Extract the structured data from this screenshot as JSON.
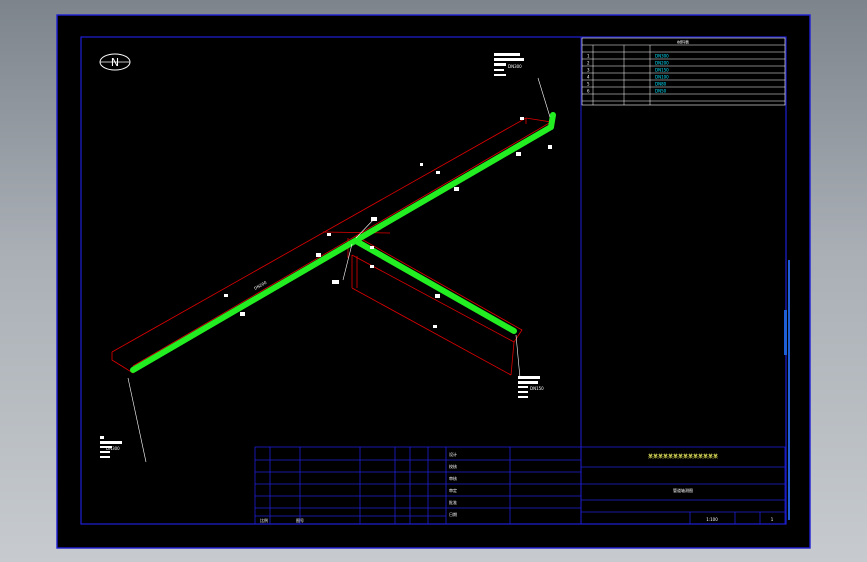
{
  "colors": {
    "background": "#000000",
    "frame": "#1f1fd6",
    "pipe": "#22ee22",
    "trench": "#e00000",
    "table_text": "#00e5ff",
    "text": "#ffffff"
  },
  "north_arrow": {
    "letter": "N"
  },
  "material_table": {
    "title": "材料表",
    "rows": [
      {
        "no": "1",
        "spec": "DN300"
      },
      {
        "no": "2",
        "spec": "DN200"
      },
      {
        "no": "3",
        "spec": "DN150"
      },
      {
        "no": "4",
        "spec": "DN100"
      },
      {
        "no": "5",
        "spec": "DN80"
      },
      {
        "no": "6",
        "spec": "DN50"
      }
    ]
  },
  "title_block": {
    "project_title": "某某某某某某某某某某某某某某",
    "drawing_name": "管道轴测图",
    "row_labels": [
      "设计",
      "校核",
      "审核",
      "审定",
      "批准",
      "日期"
    ],
    "footer_left": "比例",
    "footer_mid": "图号",
    "scale_value": "1:100",
    "sheet": "1"
  },
  "annotations": {
    "tag_top": "DN300",
    "tag_mid": "DN200",
    "tag_right": "DN150",
    "tag_left": "DN300"
  }
}
